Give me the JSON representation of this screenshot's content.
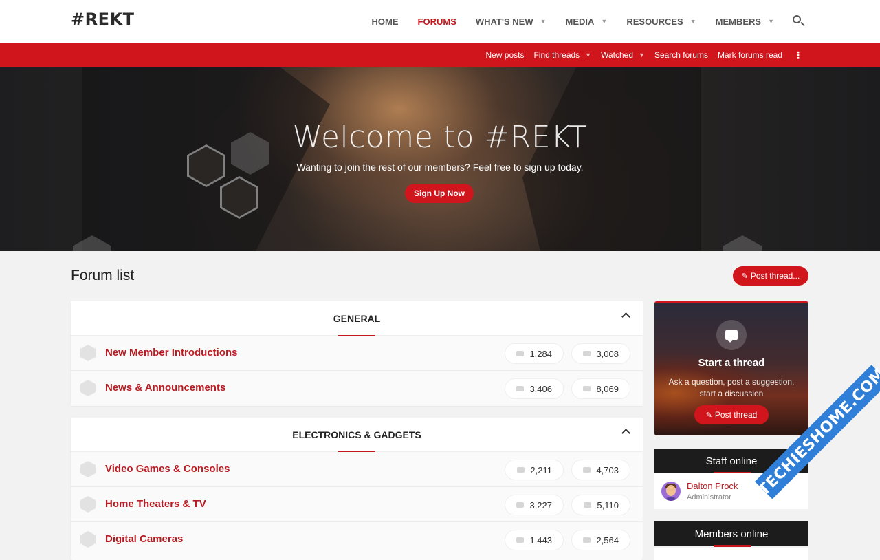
{
  "header": {
    "logo": "#REKT",
    "nav": [
      {
        "label": "HOME",
        "active": false,
        "dropdown": false
      },
      {
        "label": "FORUMS",
        "active": true,
        "dropdown": false
      },
      {
        "label": "WHAT'S NEW",
        "active": false,
        "dropdown": true
      },
      {
        "label": "MEDIA",
        "active": false,
        "dropdown": true
      },
      {
        "label": "RESOURCES",
        "active": false,
        "dropdown": true
      },
      {
        "label": "MEMBERS",
        "active": false,
        "dropdown": true
      }
    ],
    "search_icon": "search-icon"
  },
  "subnav": {
    "items": [
      {
        "label": "New posts",
        "dropdown": false
      },
      {
        "label": "Find threads",
        "dropdown": true
      },
      {
        "label": "Watched",
        "dropdown": true
      },
      {
        "label": "Search forums",
        "dropdown": false
      },
      {
        "label": "Mark forums read",
        "dropdown": false
      }
    ],
    "more": "⋮"
  },
  "hero": {
    "title": "Welcome to #REKT",
    "subtitle": "Wanting to join the rest of our members? Feel free to sign up today.",
    "button": "Sign Up Now"
  },
  "main": {
    "title": "Forum list",
    "post_thread": "Post thread..."
  },
  "categories": [
    {
      "title": "GENERAL",
      "forums": [
        {
          "name": "New Member Introductions",
          "threads": "1,284",
          "messages": "3,008"
        },
        {
          "name": "News & Announcements",
          "threads": "3,406",
          "messages": "8,069"
        }
      ]
    },
    {
      "title": "ELECTRONICS & GADGETS",
      "forums": [
        {
          "name": "Video Games & Consoles",
          "threads": "2,211",
          "messages": "4,703"
        },
        {
          "name": "Home Theaters & TV",
          "threads": "3,227",
          "messages": "5,110"
        },
        {
          "name": "Digital Cameras",
          "threads": "1,443",
          "messages": "2,564"
        }
      ]
    }
  ],
  "sidebar": {
    "start": {
      "title": "Start a thread",
      "desc": "Ask a question, post a suggestion, start a discussion",
      "button": "Post thread"
    },
    "staff": {
      "title": "Staff online",
      "name": "Dalton Prock",
      "role": "Administrator"
    },
    "members": {
      "title": "Members online"
    }
  },
  "watermark": "TECHIESHOME.COM",
  "colors": {
    "accent": "#d0161c",
    "link": "#b81c22",
    "dark": "#1c1c1c"
  }
}
